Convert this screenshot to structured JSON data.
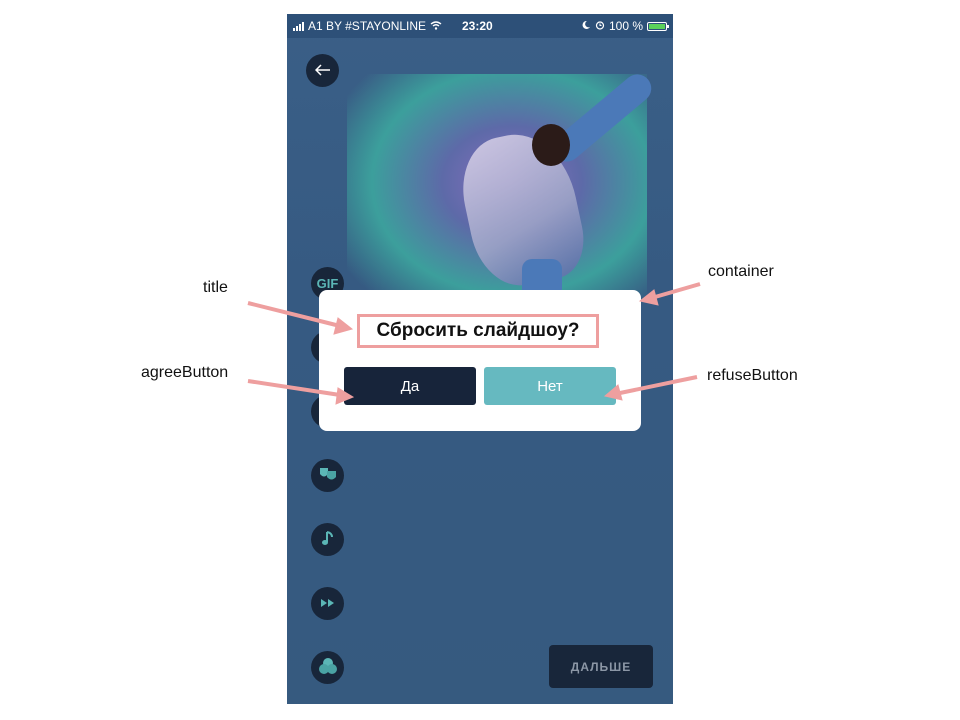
{
  "status_bar": {
    "carrier": "A1 BY #STAYONLINE",
    "time": "23:20",
    "battery": "100 %"
  },
  "dialog": {
    "title": "Сбросить слайдшоу?",
    "agree_label": "Да",
    "refuse_label": "Нет"
  },
  "toolbar": {
    "gif_label": "GIF",
    "next_label": "ДАЛЬШЕ"
  },
  "annotations": {
    "title": "title",
    "container": "container",
    "agree": "agreeButton",
    "refuse": "refuseButton"
  },
  "colors": {
    "annotation_arrow": "#ee9f9f",
    "dark_button": "#17243a",
    "teal_button": "#66b9c0"
  }
}
